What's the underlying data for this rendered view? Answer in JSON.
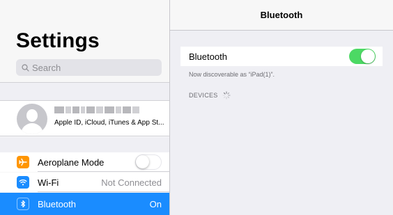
{
  "sidebar": {
    "title": "Settings",
    "search_placeholder": "Search",
    "account": {
      "subtitle": "Apple ID, iCloud, iTunes & App St..."
    },
    "items": [
      {
        "label": "Aeroplane Mode",
        "icon": "airplane-icon",
        "color": "#ff9500",
        "value": "",
        "toggle": "off"
      },
      {
        "label": "Wi-Fi",
        "icon": "wifi-icon",
        "color": "#1a8cff",
        "value": "Not Connected"
      },
      {
        "label": "Bluetooth",
        "icon": "bluetooth-icon",
        "color": "#1a8cff",
        "value": "On",
        "selected": true
      }
    ]
  },
  "detail": {
    "nav_title": "Bluetooth",
    "bluetooth_label": "Bluetooth",
    "bluetooth_toggle": "on",
    "discoverable_text": "Now discoverable as “iPad(1)”.",
    "devices_header": "DEVICES"
  },
  "colors": {
    "accent": "#1a8cff",
    "toggle_on": "#4cd964",
    "airplane": "#ff9500"
  }
}
